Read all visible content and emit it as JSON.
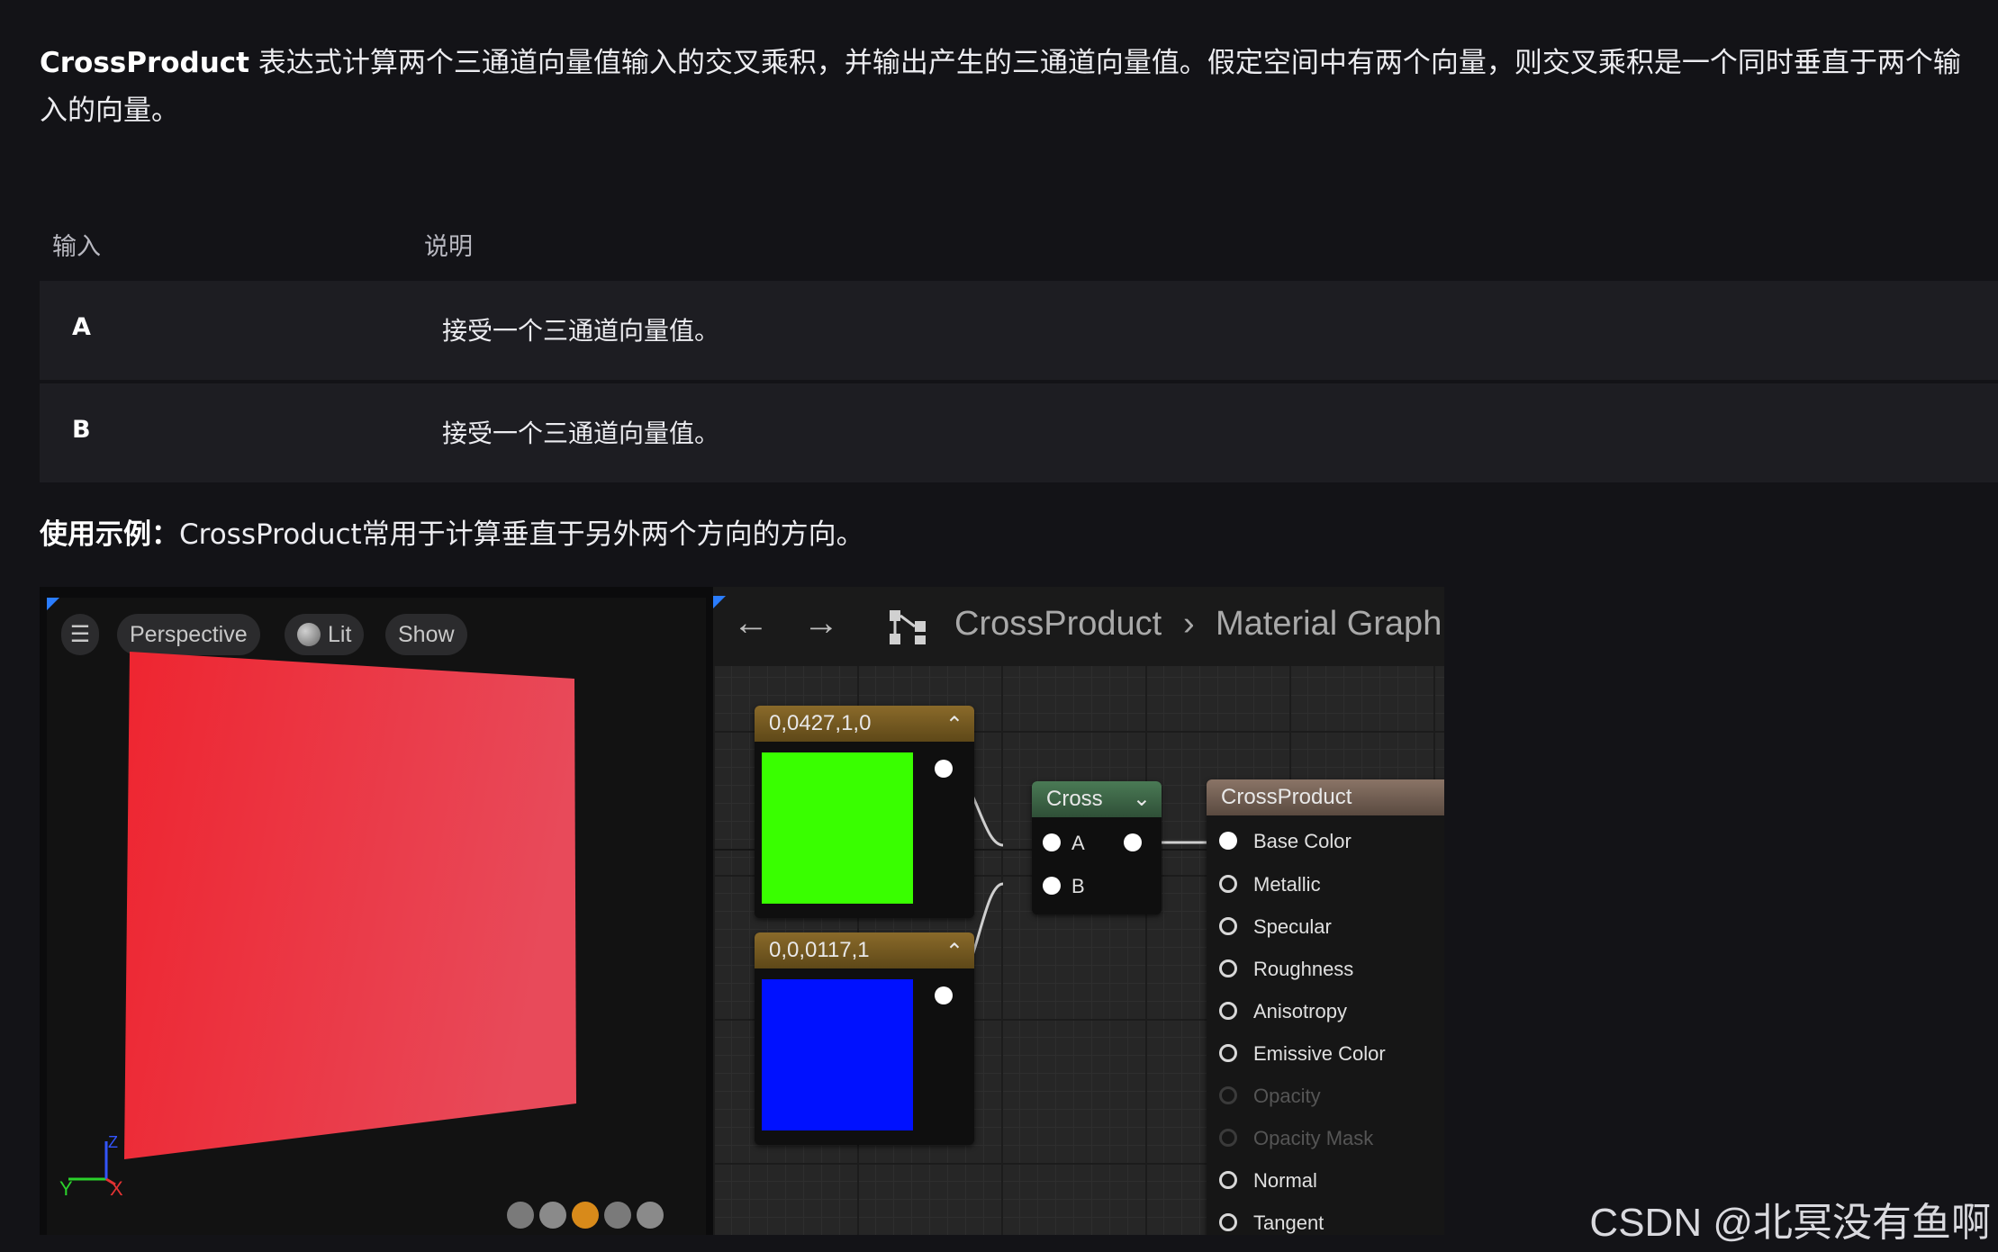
{
  "intro": {
    "term": "CrossProduct",
    "text": " 表达式计算两个三通道向量值输入的交叉乘积，并输出产生的三通道向量值。假定空间中有两个向量，则交叉乘积是一个同时垂直于两个输入的向量。"
  },
  "table": {
    "headers": [
      "输入",
      "说明"
    ],
    "rows": [
      {
        "key": "A",
        "value": "接受一个三通道向量值。"
      },
      {
        "key": "B",
        "value": "接受一个三通道向量值。"
      }
    ]
  },
  "example": {
    "label": "使用示例：",
    "text": "CrossProduct常用于计算垂直于另外两个方向的方向。"
  },
  "viewport": {
    "menu_icon": "☰",
    "perspective": "Perspective",
    "lit": "Lit",
    "show": "Show",
    "axis_y": "Y",
    "axis_x": "X",
    "axis_z": "Z"
  },
  "graph": {
    "back_icon": "←",
    "forward_icon": "→",
    "breadcrumb_root": "CrossProduct",
    "breadcrumb_sep": "›",
    "breadcrumb_page": "Material Graph",
    "const_a_label": "0,0427,1,0",
    "const_b_label": "0,0,0117,1",
    "collapse_icon": "⌃",
    "cross_title": "Cross",
    "cross_dropdown_icon": "⌄",
    "cross_pin_a": "A",
    "cross_pin_b": "B",
    "material_title": "CrossProduct",
    "material_pins": [
      "Base Color",
      "Metallic",
      "Specular",
      "Roughness",
      "Anisotropy",
      "Emissive Color",
      "Opacity",
      "Opacity Mask",
      "Normal",
      "Tangent"
    ],
    "disabled_pins": [
      "Opacity",
      "Opacity Mask"
    ],
    "colors": {
      "green": "#39ff00",
      "blue": "#0011ff",
      "red": "#ee2a38"
    }
  },
  "watermark": "CSDN @北冥没有鱼啊"
}
